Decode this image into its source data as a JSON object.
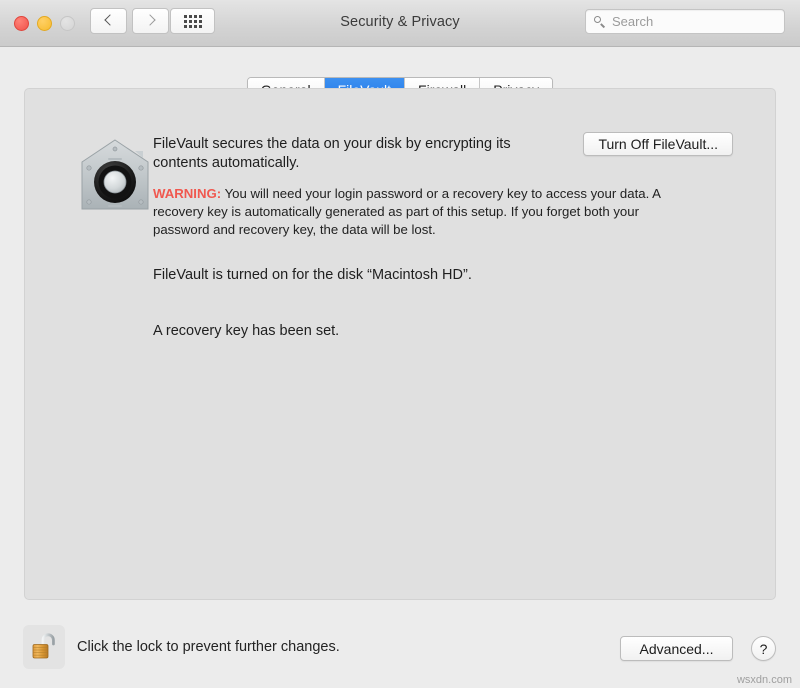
{
  "window": {
    "title": "Security & Privacy",
    "traffic_lights": [
      "close",
      "minimize",
      "zoom"
    ]
  },
  "toolbar": {
    "back_label": "‹",
    "forward_label": "›",
    "grid_label": "show-all",
    "search": {
      "placeholder": "Search",
      "value": ""
    }
  },
  "tabs": [
    {
      "label": "General",
      "selected": false
    },
    {
      "label": "FileVault",
      "selected": true
    },
    {
      "label": "Firewall",
      "selected": false
    },
    {
      "label": "Privacy",
      "selected": false
    }
  ],
  "main": {
    "icon_name": "filevault-vault-icon",
    "description": "FileVault secures the data on your disk by encrypting its contents automatically.",
    "warning_label": "WARNING:",
    "warning_text": " You will need your login password or a recovery key to access your data. A recovery key is automatically generated as part of this setup. If you forget both your password and recovery key, the data will be lost.",
    "status_line": "FileVault is turned on for the disk “Macintosh HD”.",
    "recovery_line": "A recovery key has been set.",
    "turn_off_button": "Turn Off FileVault..."
  },
  "footer": {
    "lock_icon": "padlock-open-icon",
    "lock_caption": "Click the lock to prevent further changes.",
    "advanced_button": "Advanced...",
    "help_button": "?"
  },
  "watermark": "wsxdn.com",
  "colors": {
    "accent": "#2178e8",
    "warning": "#f0584f",
    "window_bg": "#ececec",
    "panel_bg": "#e0e0e0"
  }
}
